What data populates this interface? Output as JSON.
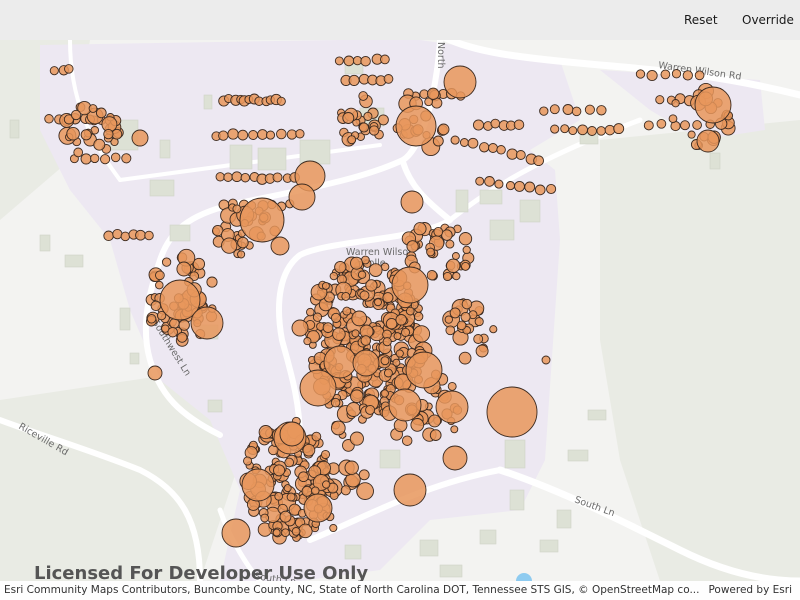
{
  "toolbar": {
    "reset_label": "Reset",
    "override_label": "Override"
  },
  "map": {
    "labels": {
      "campus_line1": "Warren Wilson",
      "campus_line2": "Colle",
      "warren_wilson_rd": "Warren Wilson Rd",
      "south_ln": "South Ln",
      "southwest_ln": "Southwest Ln",
      "riceville_rd": "Riceville Rd",
      "north_partial": "North",
      "south_ln_bottom": "South Ln"
    },
    "watermark": "Licensed For Developer Use Only",
    "attribution": "Esri Community Maps Contributors, Buncombe County, NC, State of North Carolina DOT, Tennessee STS GIS, © OpenStreetMap co...",
    "powered_by": "Powered by Esri"
  },
  "style": {
    "marker_fill": "#e8965c",
    "marker_stroke": "#3b2a20",
    "campus_fill": "#ede8f2",
    "road_color": "#ffffff",
    "basemap_color": "#f3f3f1"
  }
}
